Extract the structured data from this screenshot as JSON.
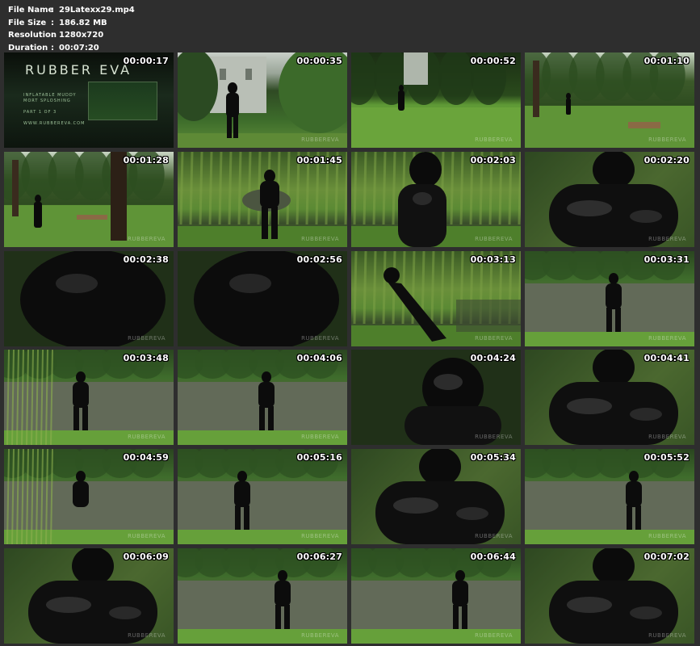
{
  "file_info": {
    "file_name_label": "File Name",
    "file_name": "29Latexx29.mp4",
    "file_size_label": "File Size",
    "file_size": "186.82 MB",
    "resolution_label": "Resolution",
    "resolution": "1280x720",
    "duration_label": "Duration",
    "duration": "00:07:20",
    "separator": ":"
  },
  "title_card": {
    "brand": "RUBBER EVA",
    "line1": "INFLATABLE MUDDY",
    "line2": "MORT SPLOSHING",
    "line3": "PART 1 OF 3",
    "url": "WWW.RUBBEREVA.COM"
  },
  "watermark": "RUBBEREVA",
  "thumbnails": [
    {
      "time": "00:00:17",
      "scene": "title"
    },
    {
      "time": "00:00:35",
      "scene": "house"
    },
    {
      "time": "00:00:52",
      "scene": "lawn"
    },
    {
      "time": "00:01:10",
      "scene": "wood"
    },
    {
      "time": "00:01:28",
      "scene": "wood"
    },
    {
      "time": "00:01:45",
      "scene": "willow"
    },
    {
      "time": "00:02:03",
      "scene": "willow"
    },
    {
      "time": "00:02:20",
      "scene": "close"
    },
    {
      "time": "00:02:38",
      "scene": "dark"
    },
    {
      "time": "00:02:56",
      "scene": "dark"
    },
    {
      "time": "00:03:13",
      "scene": "willow"
    },
    {
      "time": "00:03:31",
      "scene": "pond"
    },
    {
      "time": "00:03:48",
      "scene": "pond"
    },
    {
      "time": "00:04:06",
      "scene": "pond"
    },
    {
      "time": "00:04:24",
      "scene": "dark"
    },
    {
      "time": "00:04:41",
      "scene": "close"
    },
    {
      "time": "00:04:59",
      "scene": "pond"
    },
    {
      "time": "00:05:16",
      "scene": "pond"
    },
    {
      "time": "00:05:34",
      "scene": "close"
    },
    {
      "time": "00:05:52",
      "scene": "pond"
    },
    {
      "time": "00:06:09",
      "scene": "close"
    },
    {
      "time": "00:06:27",
      "scene": "pond"
    },
    {
      "time": "00:06:44",
      "scene": "pond"
    },
    {
      "time": "00:07:02",
      "scene": "close"
    }
  ]
}
